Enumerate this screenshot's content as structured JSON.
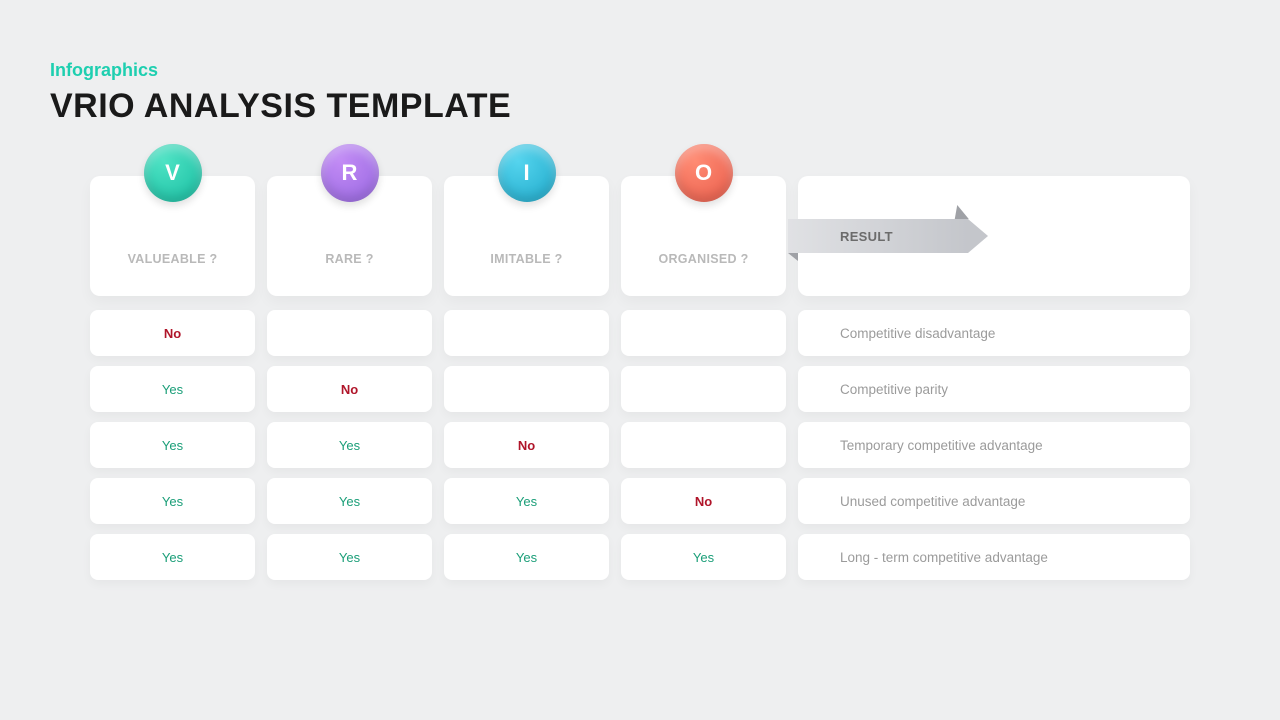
{
  "subtitle": "Infographics",
  "title": "VRIO ANALYSIS TEMPLATE",
  "columns": {
    "v": {
      "letter": "V",
      "label": "VALUEABLE ?"
    },
    "r": {
      "letter": "R",
      "label": "RARE ?"
    },
    "i": {
      "letter": "I",
      "label": "IMITABLE ?"
    },
    "o": {
      "letter": "O",
      "label": "ORGANISED ?"
    },
    "result": {
      "label": "RESULT"
    }
  },
  "rows": [
    {
      "v": "No",
      "r": "",
      "i": "",
      "o": "",
      "result": "Competitive disadvantage"
    },
    {
      "v": "Yes",
      "r": "No",
      "i": "",
      "o": "",
      "result": "Competitive parity"
    },
    {
      "v": "Yes",
      "r": "Yes",
      "i": "No",
      "o": "",
      "result": "Temporary competitive advantage"
    },
    {
      "v": "Yes",
      "r": "Yes",
      "i": "Yes",
      "o": "No",
      "result": "Unused competitive advantage"
    },
    {
      "v": "Yes",
      "r": "Yes",
      "i": "Yes",
      "o": "Yes",
      "result": "Long - term competitive advantage"
    }
  ]
}
